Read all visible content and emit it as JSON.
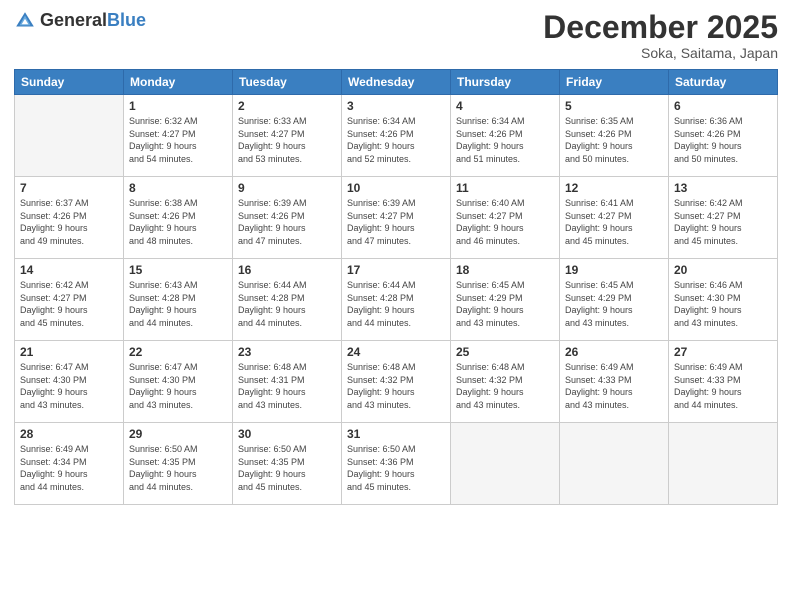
{
  "header": {
    "logo_general": "General",
    "logo_blue": "Blue",
    "month": "December 2025",
    "location": "Soka, Saitama, Japan"
  },
  "days_of_week": [
    "Sunday",
    "Monday",
    "Tuesday",
    "Wednesday",
    "Thursday",
    "Friday",
    "Saturday"
  ],
  "weeks": [
    [
      {
        "day": "",
        "info": ""
      },
      {
        "day": "1",
        "info": "Sunrise: 6:32 AM\nSunset: 4:27 PM\nDaylight: 9 hours\nand 54 minutes."
      },
      {
        "day": "2",
        "info": "Sunrise: 6:33 AM\nSunset: 4:27 PM\nDaylight: 9 hours\nand 53 minutes."
      },
      {
        "day": "3",
        "info": "Sunrise: 6:34 AM\nSunset: 4:26 PM\nDaylight: 9 hours\nand 52 minutes."
      },
      {
        "day": "4",
        "info": "Sunrise: 6:34 AM\nSunset: 4:26 PM\nDaylight: 9 hours\nand 51 minutes."
      },
      {
        "day": "5",
        "info": "Sunrise: 6:35 AM\nSunset: 4:26 PM\nDaylight: 9 hours\nand 50 minutes."
      },
      {
        "day": "6",
        "info": "Sunrise: 6:36 AM\nSunset: 4:26 PM\nDaylight: 9 hours\nand 50 minutes."
      }
    ],
    [
      {
        "day": "7",
        "info": "Sunrise: 6:37 AM\nSunset: 4:26 PM\nDaylight: 9 hours\nand 49 minutes."
      },
      {
        "day": "8",
        "info": "Sunrise: 6:38 AM\nSunset: 4:26 PM\nDaylight: 9 hours\nand 48 minutes."
      },
      {
        "day": "9",
        "info": "Sunrise: 6:39 AM\nSunset: 4:26 PM\nDaylight: 9 hours\nand 47 minutes."
      },
      {
        "day": "10",
        "info": "Sunrise: 6:39 AM\nSunset: 4:27 PM\nDaylight: 9 hours\nand 47 minutes."
      },
      {
        "day": "11",
        "info": "Sunrise: 6:40 AM\nSunset: 4:27 PM\nDaylight: 9 hours\nand 46 minutes."
      },
      {
        "day": "12",
        "info": "Sunrise: 6:41 AM\nSunset: 4:27 PM\nDaylight: 9 hours\nand 45 minutes."
      },
      {
        "day": "13",
        "info": "Sunrise: 6:42 AM\nSunset: 4:27 PM\nDaylight: 9 hours\nand 45 minutes."
      }
    ],
    [
      {
        "day": "14",
        "info": "Sunrise: 6:42 AM\nSunset: 4:27 PM\nDaylight: 9 hours\nand 45 minutes."
      },
      {
        "day": "15",
        "info": "Sunrise: 6:43 AM\nSunset: 4:28 PM\nDaylight: 9 hours\nand 44 minutes."
      },
      {
        "day": "16",
        "info": "Sunrise: 6:44 AM\nSunset: 4:28 PM\nDaylight: 9 hours\nand 44 minutes."
      },
      {
        "day": "17",
        "info": "Sunrise: 6:44 AM\nSunset: 4:28 PM\nDaylight: 9 hours\nand 44 minutes."
      },
      {
        "day": "18",
        "info": "Sunrise: 6:45 AM\nSunset: 4:29 PM\nDaylight: 9 hours\nand 43 minutes."
      },
      {
        "day": "19",
        "info": "Sunrise: 6:45 AM\nSunset: 4:29 PM\nDaylight: 9 hours\nand 43 minutes."
      },
      {
        "day": "20",
        "info": "Sunrise: 6:46 AM\nSunset: 4:30 PM\nDaylight: 9 hours\nand 43 minutes."
      }
    ],
    [
      {
        "day": "21",
        "info": "Sunrise: 6:47 AM\nSunset: 4:30 PM\nDaylight: 9 hours\nand 43 minutes."
      },
      {
        "day": "22",
        "info": "Sunrise: 6:47 AM\nSunset: 4:30 PM\nDaylight: 9 hours\nand 43 minutes."
      },
      {
        "day": "23",
        "info": "Sunrise: 6:48 AM\nSunset: 4:31 PM\nDaylight: 9 hours\nand 43 minutes."
      },
      {
        "day": "24",
        "info": "Sunrise: 6:48 AM\nSunset: 4:32 PM\nDaylight: 9 hours\nand 43 minutes."
      },
      {
        "day": "25",
        "info": "Sunrise: 6:48 AM\nSunset: 4:32 PM\nDaylight: 9 hours\nand 43 minutes."
      },
      {
        "day": "26",
        "info": "Sunrise: 6:49 AM\nSunset: 4:33 PM\nDaylight: 9 hours\nand 43 minutes."
      },
      {
        "day": "27",
        "info": "Sunrise: 6:49 AM\nSunset: 4:33 PM\nDaylight: 9 hours\nand 44 minutes."
      }
    ],
    [
      {
        "day": "28",
        "info": "Sunrise: 6:49 AM\nSunset: 4:34 PM\nDaylight: 9 hours\nand 44 minutes."
      },
      {
        "day": "29",
        "info": "Sunrise: 6:50 AM\nSunset: 4:35 PM\nDaylight: 9 hours\nand 44 minutes."
      },
      {
        "day": "30",
        "info": "Sunrise: 6:50 AM\nSunset: 4:35 PM\nDaylight: 9 hours\nand 45 minutes."
      },
      {
        "day": "31",
        "info": "Sunrise: 6:50 AM\nSunset: 4:36 PM\nDaylight: 9 hours\nand 45 minutes."
      },
      {
        "day": "",
        "info": ""
      },
      {
        "day": "",
        "info": ""
      },
      {
        "day": "",
        "info": ""
      }
    ]
  ]
}
